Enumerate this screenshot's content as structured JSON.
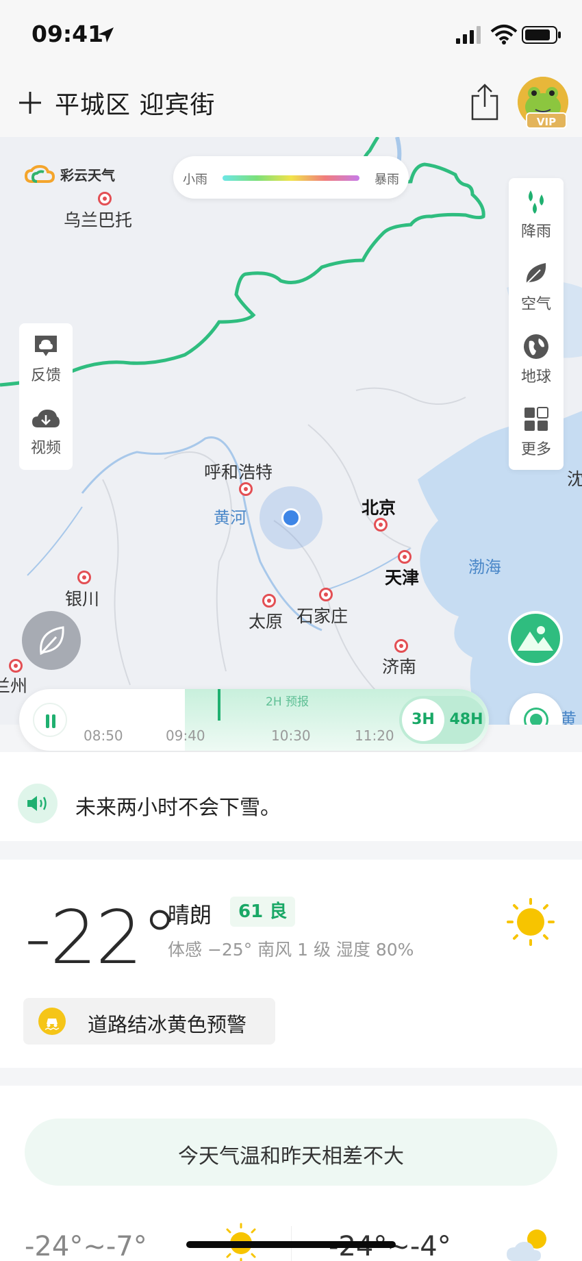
{
  "status_bar": {
    "time": "09:41"
  },
  "header": {
    "location": "平城区 迎宾街",
    "vip": "VIP"
  },
  "map": {
    "logo": "彩云天气",
    "legend": {
      "light": "小雨",
      "heavy": "暴雨"
    },
    "right_panel": [
      {
        "label": "降雨",
        "icon": "rain-drops-icon"
      },
      {
        "label": "空气",
        "icon": "leaf-icon"
      },
      {
        "label": "地球",
        "icon": "globe-icon"
      },
      {
        "label": "更多",
        "icon": "grid-icon"
      }
    ],
    "left_panel": [
      {
        "label": "反馈",
        "icon": "feedback-icon"
      },
      {
        "label": "视频",
        "icon": "video-download-icon"
      }
    ],
    "cities": {
      "wulanbatuo": "乌兰巴托",
      "huhehaote": "呼和浩特",
      "beijing": "北京",
      "tianjin": "天津",
      "shijiazhuang": "石家庄",
      "taiyuan": "太原",
      "yinchuan": "银川",
      "lanzhou": "兰州",
      "jinan": "济南",
      "shen": "沈",
      "huang": "黄"
    },
    "water": {
      "yellow_river": "黄河",
      "bohai": "渤海"
    }
  },
  "timeline": {
    "forecast_label": "2H 预报",
    "ticks": [
      "08:50",
      "09:40",
      "10:30",
      "11:20"
    ],
    "toggle_3h": "3H",
    "toggle_48h": "48H"
  },
  "notice": {
    "text": "未来两小时不会下雪。"
  },
  "current": {
    "temperature": "-22°",
    "condition": "晴朗",
    "aqi": "61 良",
    "details": "体感 −25° 南风 1 级 湿度 80%",
    "warning": "道路结冰黄色预警"
  },
  "compare": {
    "text": "今天气温和昨天相差不大"
  },
  "daily": {
    "left_range": "-24°~-7°",
    "right_range": "-24°~-4°"
  }
}
